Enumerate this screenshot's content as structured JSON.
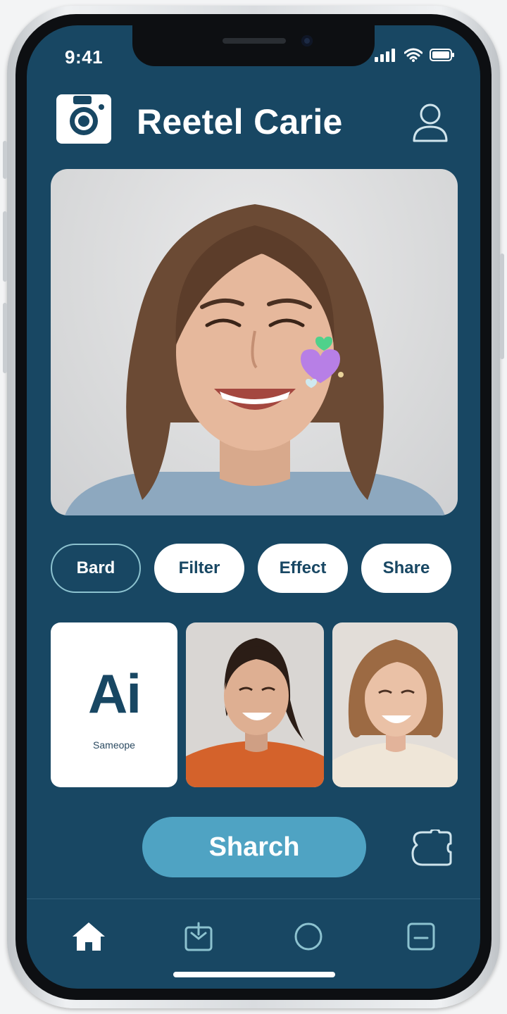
{
  "status_bar": {
    "time": "9:41"
  },
  "header": {
    "title": "Reetel Carie",
    "logo_icon": "camera-icon",
    "profile_icon": "user-icon"
  },
  "hero": {
    "description_icon": "portrait-photo"
  },
  "actions": {
    "items": [
      {
        "label": "Bard",
        "style": "outline"
      },
      {
        "label": "Filter",
        "style": "solid"
      },
      {
        "label": "Effect",
        "style": "solid"
      },
      {
        "label": "Share",
        "style": "solid"
      }
    ]
  },
  "gallery": {
    "ai_card": {
      "big": "Ai",
      "small": "Sameope"
    }
  },
  "search": {
    "label": "Sharch"
  },
  "colors": {
    "background": "#184763",
    "accent": "#4fa3c3",
    "white": "#ffffff"
  },
  "nav": {
    "items": [
      "home-icon",
      "box-icon",
      "circle-icon",
      "minus-square-icon"
    ]
  }
}
